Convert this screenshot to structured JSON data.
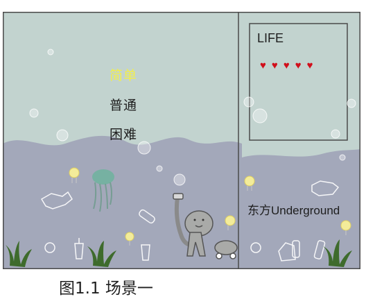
{
  "menu": {
    "items": [
      {
        "label": "简单",
        "state": "selected"
      },
      {
        "label": "普通"
      },
      {
        "label": "困难"
      }
    ],
    "selected_color": "#f3ef4a"
  },
  "hud": {
    "life_label": "LIFE",
    "lives_remaining": 5,
    "heart_symbol": "♥",
    "heart_color": "#d10f1b"
  },
  "game_title": "东方Underground",
  "caption": "图1.1 场景一",
  "colors": {
    "water": "#c2d3cf",
    "seabed": "#a3a8ba",
    "border": "#4a4a4a",
    "seaweed": "#3e6b2c"
  },
  "icons": [
    "bubble-icon",
    "jellyfish-icon",
    "trash-bag-icon",
    "bottle-icon",
    "seaweed-icon",
    "diver-character-icon",
    "pet-robot-icon",
    "cup-icon"
  ]
}
